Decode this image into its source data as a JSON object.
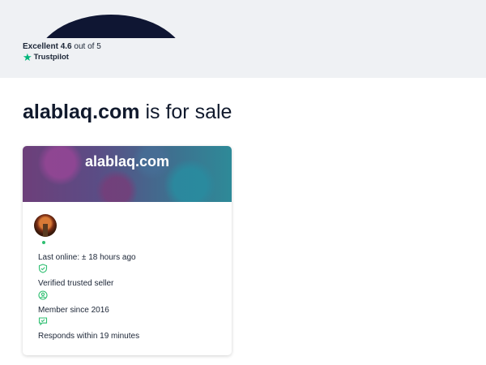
{
  "rating": {
    "label": "Excellent",
    "score": "4.6",
    "suffix": "out of 5",
    "provider": "Trustpilot"
  },
  "headline": {
    "domain": "alablaq.com",
    "rest": "is for sale"
  },
  "card": {
    "banner_title": "alablaq.com",
    "last_online": "Last online: ± 18 hours ago",
    "verified": "Verified trusted seller",
    "member_since": "Member since 2016",
    "responds": "Responds within 19 minutes"
  },
  "colors": {
    "accent_green": "#2fbf71",
    "trustpilot_green": "#00b67a",
    "text_dark": "#1b2536"
  }
}
